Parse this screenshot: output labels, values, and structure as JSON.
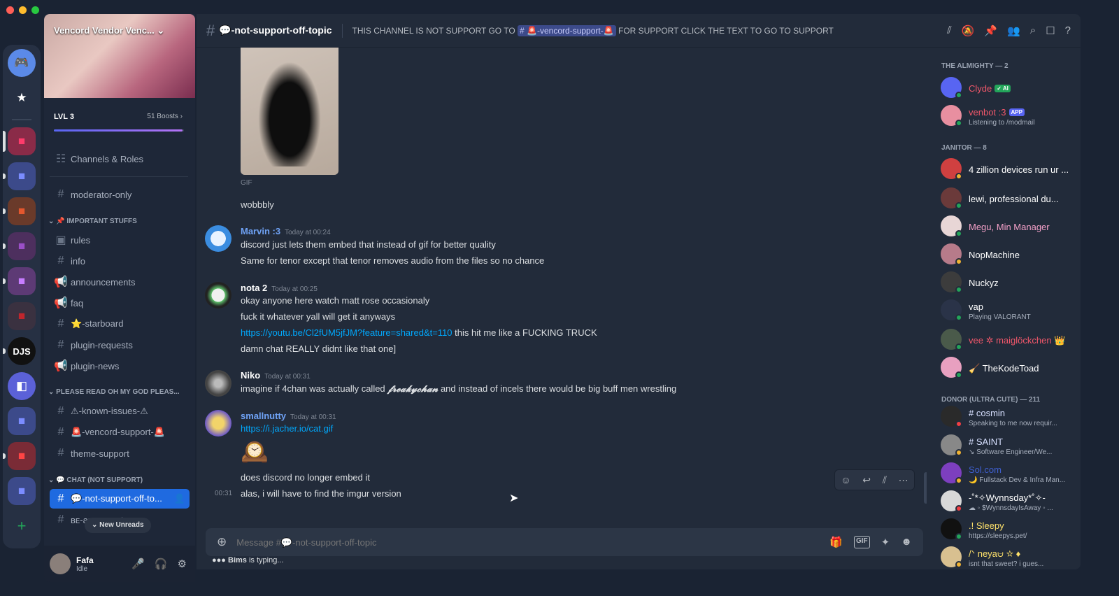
{
  "window": {
    "close": "#ff5f57",
    "min": "#febc2e",
    "max": "#28c840"
  },
  "servers": [
    "discord-home",
    "favorites-star",
    "folder-red",
    "folder-blue",
    "folder-orange",
    "folder-purple",
    "folder-purple2",
    "folder-red2",
    "djs",
    "server-purple-t",
    "folder-blue2",
    "folder-red3",
    "folder-blue3",
    "add-server"
  ],
  "guild": {
    "name": "Vencord Vendor Venc...",
    "level": "LVL 3",
    "boosts": "51 Boosts",
    "boost_progress": 0.99,
    "channels_roles": "Channels & Roles"
  },
  "channels": {
    "moderator": "moderator-only",
    "cat_important": "IMPORTANT STUFFS",
    "rules": "rules",
    "info": "info",
    "announcements": "announcements",
    "faq": "faq",
    "starboard": "⭐-starboard",
    "plugin_requests": "plugin-requests",
    "plugin_news": "plugin-news",
    "cat_please": "PLEASE READ OH MY GOD PLEAS...",
    "known_issues": "⚠-known-issues-⚠",
    "vencord_support": "🚨-vencord-support-🚨",
    "theme_support": "theme-support",
    "cat_chat": "💬 CHAT (NOT SUPPORT)",
    "not_support": "💬-not-support-off-to...",
    "be_au": "ʙᴇ-au... ...unter...",
    "new_unreads": "New Unreads"
  },
  "user": {
    "name": "Fafa",
    "status": "Idle"
  },
  "header": {
    "channel": "💬-not-support-off-topic",
    "topic_pre": "THIS CHANNEL IS NOT SUPPORT GO TO",
    "topic_mention": "🚨-vencord-support-🚨",
    "topic_post": "FOR SUPPORT CLICK THE TEXT TO GO TO SUPPORT"
  },
  "messages": {
    "gif_label": "GIF",
    "wobbly": "wobbbly",
    "m1": {
      "author": "Marvin :3",
      "time": "Today at 00:24",
      "l1": "discord just lets them embed that instead of gif for better quality",
      "l2": "Same for tenor except that tenor removes audio from the files so no chance"
    },
    "m2": {
      "author": "nota 2",
      "time": "Today at 00:25",
      "l1": "okay anyone here watch matt rose occasionaly",
      "l2": "fuck it whatever yall will get it anyways",
      "link": "https://youtu.be/Cl2fUM5jfJM?feature=shared&t=110",
      "link_after": "this hit me like a FUCKING TRUCK",
      "l4": "damn chat REALLY didnt like that one]"
    },
    "m3": {
      "author": "Niko",
      "time": "Today at 00:31",
      "pre": "imagine if 4chan was actually called",
      "fancy": "𝓯𝓻𝓮𝓪𝓴𝔂𝓬𝓱𝓪𝓷",
      "post": "and instead of incels there would be big buff men wrestling"
    },
    "m4": {
      "author": "smallnutty",
      "time": "Today at 00:31",
      "link": "https://i.jacher.io/cat.gif",
      "clock": "🕰️",
      "l2": "does discord no longer embed it",
      "t3": "00:31",
      "l3": "alas, i will have to find the imgur version"
    }
  },
  "composer": {
    "placeholder": "Message #💬-not-support-off-topic",
    "typing_user": "Bims",
    "typing_text": "is typing..."
  },
  "members": {
    "cat1": "THE ALMIGHTY — 2",
    "cat2": "JANITOR — 8",
    "cat3": "DONOR (ULTRA CUTE) — 211",
    "list": [
      {
        "name": "Clyde",
        "badge": "✓ AI",
        "sub": "",
        "color": "#f0576a"
      },
      {
        "name": "venbot :3",
        "badge": "APP",
        "sub": "Listening to /modmail",
        "color": "#f0576a"
      },
      {
        "name": "4 zillion devices run ur ...",
        "badge": "",
        "sub": "",
        "color": "#ffffff"
      },
      {
        "name": "lewi, professional du...",
        "badge": "",
        "sub": "",
        "color": "#ffffff"
      },
      {
        "name": "Megu, Min Manager",
        "badge": "",
        "sub": "",
        "color": "#f3a0c8"
      },
      {
        "name": "NopMachine",
        "badge": "",
        "sub": "",
        "color": "#ffffff"
      },
      {
        "name": "Nuckyz",
        "badge": "",
        "sub": "",
        "color": "#ffffff"
      },
      {
        "name": "vap",
        "badge": "",
        "sub": "Playing VALORANT",
        "color": "#ffffff"
      },
      {
        "name": "vee ✲ maiglöckchen 👑",
        "badge": "",
        "sub": "",
        "color": "#f0576a"
      },
      {
        "name": "🧹 TheKodeToad",
        "badge": "",
        "sub": "",
        "color": "#ffffff"
      },
      {
        "name": "# cosmin",
        "badge": "",
        "sub": "Speaking to me now requir...",
        "color": "#d7e0ff"
      },
      {
        "name": "# SAINT",
        "badge": "",
        "sub": "↘ Software Engineer/We...",
        "color": "#d7e0ff"
      },
      {
        "name": "Sol.com",
        "badge": "",
        "sub": "🌙 Fullstack Dev & Infra Man...",
        "color": "#3f5fd0"
      },
      {
        "name": "-˚*✧Wynnsday*˚✧-",
        "badge": "",
        "sub": "☁ ◦ $WynnsdayIsAway ◦ ...",
        "color": "#ffffff"
      },
      {
        "name": ".! Sleepy",
        "badge": "",
        "sub": "https://sleepys.pet/",
        "color": "#ffe26b"
      },
      {
        "name": "/ᐠ neya⩁ ☆ ♦",
        "badge": "",
        "sub": "isnt that sweet? i gues...",
        "color": "#ffe26b"
      }
    ]
  }
}
